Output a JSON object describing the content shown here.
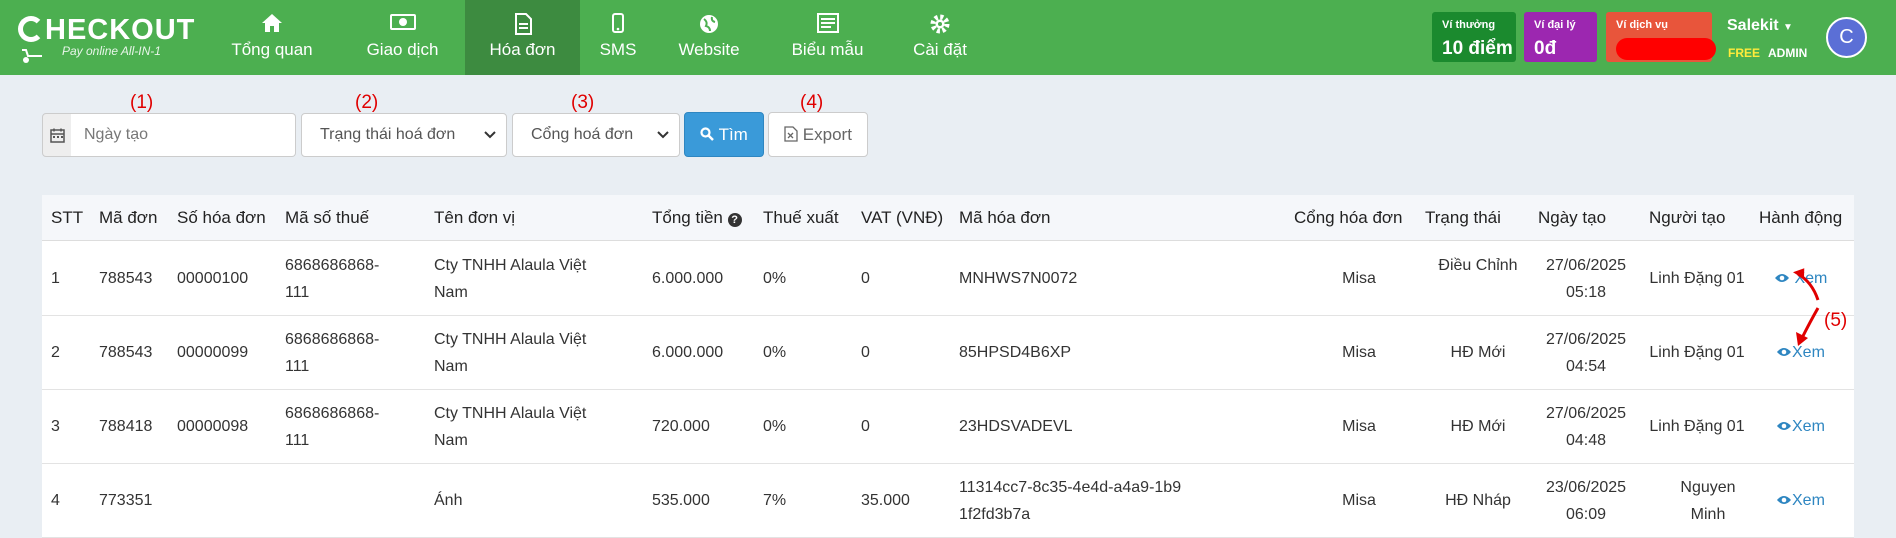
{
  "logo": {
    "title": "HECKOUT",
    "subtitle": "Pay online All-IN-1"
  },
  "nav": [
    {
      "label": "Tổng quan",
      "icon": "home-icon"
    },
    {
      "label": "Giao dịch",
      "icon": "money-icon"
    },
    {
      "label": "Hóa đơn",
      "icon": "file-icon",
      "active": true
    },
    {
      "label": "SMS",
      "icon": "mobile-icon"
    },
    {
      "label": "Website",
      "icon": "globe-icon"
    },
    {
      "label": "Biểu mẫu",
      "icon": "form-icon"
    },
    {
      "label": "Cài đặt",
      "icon": "gear-icon"
    }
  ],
  "wallets": [
    {
      "title": "Ví thưởng",
      "value": "10 điểm",
      "color": "#1b8a2e"
    },
    {
      "title": "Ví đại lý",
      "value": "0đ",
      "color": "#9c27b0"
    },
    {
      "title": "Ví dịch vụ",
      "value": "",
      "color": "#e8553b"
    }
  ],
  "user": {
    "name": "Salekit",
    "plan": "FREE",
    "role": "ADMIN",
    "initial": "C"
  },
  "filters": {
    "date_placeholder": "Ngày tạo",
    "status_select": "Trạng thái hoá đơn",
    "gateway_select": "Cổng hoá đơn",
    "search_label": "Tìm",
    "export_label": "Export"
  },
  "annotations": [
    "(1)",
    "(2)",
    "(3)",
    "(4)",
    "(5)"
  ],
  "table": {
    "headers": [
      "STT",
      "Mã đơn",
      "Số hóa đơn",
      "Mã số thuế",
      "Tên đơn vị",
      "Tổng tiền",
      "Thuế xuất",
      "VAT (VNĐ)",
      "Mã hóa đơn",
      "Cổng hóa đơn",
      "Trạng thái",
      "Ngày tạo",
      "Người tạo",
      "Hành động"
    ],
    "rows": [
      {
        "stt": "1",
        "ma_don": "788543",
        "so_hd": "00000100",
        "mst": "6868686868-111",
        "ten": "Cty TNHH Alaula Việt Nam",
        "tong": "6.000.000",
        "thue": "0%",
        "vat": "0",
        "ma_hd": "MNHWS7N0072",
        "cong": "Misa",
        "trang_thai": "Điều Chỉnh",
        "ngay": "27/06/2025 05:18",
        "nguoi": "Linh Đặng 01",
        "action": "Xem"
      },
      {
        "stt": "2",
        "ma_don": "788543",
        "so_hd": "00000099",
        "mst": "6868686868-111",
        "ten": "Cty TNHH Alaula Việt Nam",
        "tong": "6.000.000",
        "thue": "0%",
        "vat": "0",
        "ma_hd": "85HPSD4B6XP",
        "cong": "Misa",
        "trang_thai": "HĐ Mới",
        "ngay": "27/06/2025 04:54",
        "nguoi": "Linh Đặng 01",
        "action": "Xem"
      },
      {
        "stt": "3",
        "ma_don": "788418",
        "so_hd": "00000098",
        "mst": "6868686868-111",
        "ten": "Cty TNHH Alaula Việt Nam",
        "tong": "720.000",
        "thue": "0%",
        "vat": "0",
        "ma_hd": "23HDSVADEVL",
        "cong": "Misa",
        "trang_thai": "HĐ Mới",
        "ngay": "27/06/2025 04:48",
        "nguoi": "Linh Đặng 01",
        "action": "Xem"
      },
      {
        "stt": "4",
        "ma_don": "773351",
        "so_hd": "",
        "mst": "",
        "ten": "Ánh",
        "tong": "535.000",
        "thue": "7%",
        "vat": "35.000",
        "ma_hd": "11314cc7-8c35-4e4d-a4a9-1b91f2fd3b7a",
        "cong": "Misa",
        "trang_thai": "HĐ Nháp",
        "ngay": "23/06/2025 06:09",
        "nguoi": "Nguyen Minh",
        "action": "Xem"
      }
    ]
  }
}
